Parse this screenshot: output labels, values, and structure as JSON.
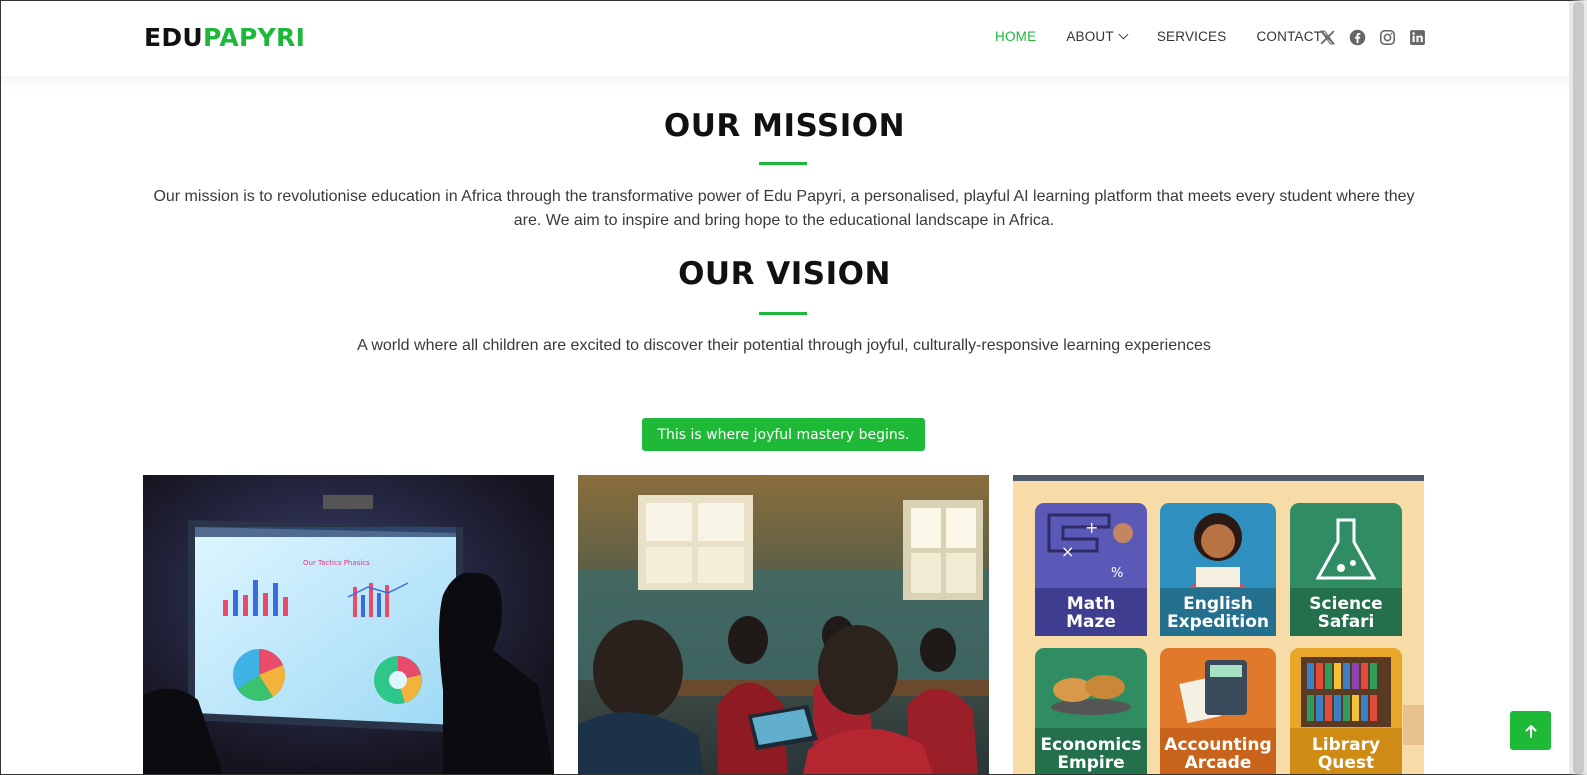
{
  "header": {
    "logo_part1": "EDU",
    "logo_part2": "PAPYRI",
    "nav": [
      {
        "label": "HOME",
        "active": true
      },
      {
        "label": "ABOUT",
        "dropdown": true
      },
      {
        "label": "SERVICES"
      },
      {
        "label": "CONTACT"
      }
    ],
    "socials": [
      "x-icon",
      "facebook-icon",
      "instagram-icon",
      "linkedin-icon"
    ]
  },
  "mission": {
    "title": "OUR MISSION",
    "text": "Our mission is to revolutionise education in Africa through the transformative power of Edu Papyri, a personalised, playful AI learning platform that meets every student where they are. We aim to inspire and bring hope to the educational landscape in Africa."
  },
  "vision": {
    "title": "OUR VISION",
    "text": "A world where all children are excited to discover their potential through joyful, culturally-responsive learning experiences"
  },
  "cta": {
    "label": "This is where joyful mastery begins."
  },
  "gallery": {
    "card1_screen_title": "Our Tactics Phasics",
    "games": [
      {
        "line1": "Math",
        "line2": "Maze"
      },
      {
        "line1": "English",
        "line2": "Expedition"
      },
      {
        "line1": "Science",
        "line2": "Safari"
      },
      {
        "line1": "Economics",
        "line2": "Empire"
      },
      {
        "line1": "Accounting",
        "line2": "Arcade"
      },
      {
        "line1": "Library",
        "line2": "Quest"
      }
    ]
  },
  "colors": {
    "brand_green": "#1db83a",
    "text_dark": "#111111"
  },
  "back_to_top_icon": "arrow-up-icon"
}
